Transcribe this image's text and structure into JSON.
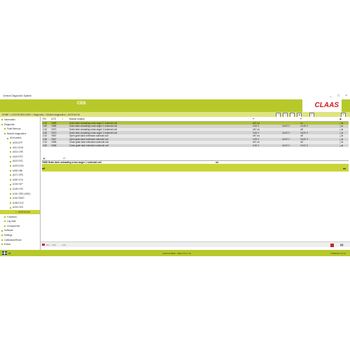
{
  "window": {
    "title": "Central Diagnostic System",
    "controls": [
      "_",
      "□",
      "×"
    ]
  },
  "header": {
    "app_name": "CDS",
    "brand": "CLAAS"
  },
  "navbar": {
    "breadcrumb": "HOME > LEXION 8000-5000 > Diagnostic > Module diagnostics > A078 ACHU",
    "toolbar_icons": [
      "view-icon",
      "print-icon",
      "zoom-icon",
      "camera-icon",
      "key-icon",
      "menu-icon"
    ]
  },
  "sidebar": {
    "items": [
      {
        "label": "Information",
        "indent": 0
      },
      {
        "label": "Diagnostic",
        "indent": 0
      },
      {
        "label": "Fault Memory",
        "indent": 1
      },
      {
        "label": "Module diagnostics",
        "indent": 1
      },
      {
        "label": "All modules",
        "indent": 2
      },
      {
        "label": "A003 ATP",
        "indent": 3
      },
      {
        "label": "A011 ECM",
        "indent": 3
      },
      {
        "label": "A016 CHE",
        "indent": 3
      },
      {
        "label": "A020 RTS",
        "indent": 3
      },
      {
        "label": "A022 ESC",
        "indent": 3
      },
      {
        "label": "A023 DCM",
        "indent": 3
      },
      {
        "label": "A050 HMI",
        "indent": 3
      },
      {
        "label": "A071 OPS",
        "indent": 3
      },
      {
        "label": "A090 VCU",
        "indent": 3
      },
      {
        "label": "A104 HLP",
        "indent": 3
      },
      {
        "label": "A105 LFM",
        "indent": 3
      },
      {
        "label": "A161 GRD (4WD)",
        "indent": 3
      },
      {
        "label": "A162 SIMO",
        "indent": 3
      },
      {
        "label": "A166 ICU2",
        "indent": 3
      },
      {
        "label": "A203 CEG",
        "indent": 3
      },
      {
        "label": "A078 ACHU",
        "indent": 3,
        "selected": true
      },
      {
        "label": "Functions",
        "indent": 1
      },
      {
        "label": "Log data",
        "indent": 1
      },
      {
        "label": "Components",
        "indent": 1
      },
      {
        "label": "Software",
        "indent": 0
      },
      {
        "label": "Settings",
        "indent": 0
      },
      {
        "label": "Calibration/Reset",
        "indent": 0
      },
      {
        "label": "Extras",
        "indent": 0
      }
    ]
  },
  "table": {
    "headers": [
      "Pin",
      "CCS",
      "",
      "Module outputs",
      "",
      "",
      "",
      ""
    ],
    "rows": [
      {
        "pin": "2.10",
        "ccs": "Y685",
        "name": "Grain tank unloading cross auger 1 solenoid coil",
        "state": "off / on",
        "value": "on",
        "highlight": true
      },
      {
        "pin": "3.50",
        "ccs": "Y685",
        "name": "Grain tank unloading cross auger 1 solenoid coil",
        "state": "0.00 V",
        "v2": "16.00 V",
        "value": "13.40 V"
      },
      {
        "pin": "2.10",
        "ccs": "Y670",
        "name": "Grain tank unloading cross auger 2 solenoid coil",
        "state": "off / on",
        "value": "off"
      },
      {
        "pin": "3.50",
        "ccs": "Y670",
        "name": "Grain tank unloading cross auger 2 solenoid coil",
        "state": "0.00 V",
        "v2": "16.00 V",
        "value": "16.00 V"
      },
      {
        "pin": "2.10",
        "ccs": "Y667",
        "name": "Open grain tank extension solenoid coil",
        "state": "off / on",
        "value": "off"
      },
      {
        "pin": "3.50",
        "ccs": "Y667",
        "name": "Open grain tank extension solenoid coil",
        "state": "0.00 V",
        "v2": "16.00 V",
        "value": "16.00 V"
      },
      {
        "pin": "2.10",
        "ccs": "Y668",
        "name": "Close grain tank extension solenoid coil",
        "state": "off / on",
        "value": "off"
      },
      {
        "pin": "3.50",
        "ccs": "Y668",
        "name": "Close grain tank extension solenoid coil",
        "state": "0.00 V",
        "v2": "16.00 V",
        "value": "13.02 V"
      }
    ]
  },
  "detail": {
    "tabs": [
      "",
      ""
    ],
    "title": "Y685  Grain tank unloading cross auger 1 solenoid coil",
    "value": "on",
    "bar_left": "off",
    "bar_right": "on"
  },
  "bottom": {
    "items": [
      "ON",
      "0.00",
      "◄ ►"
    ]
  },
  "status": {
    "center": "LEXION 8000 - 5000 V17.1.16",
    "right": "7/28/2021  14:12"
  },
  "colors": {
    "accent": "#b7c92a",
    "highlight": "#b4c52a",
    "brand_red": "#d2141e"
  }
}
